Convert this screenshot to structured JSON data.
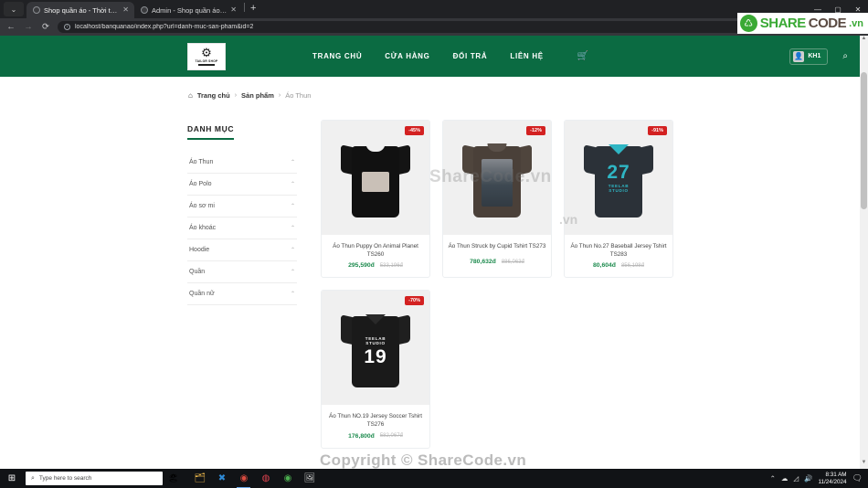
{
  "browser": {
    "tabs": [
      {
        "title": "Shop quần áo - Thời trang",
        "active": true
      },
      {
        "title": "Admin - Shop quần áo - Thời t",
        "active": false
      }
    ],
    "new_tab_label": "+",
    "tab_close_label": "✕",
    "tab_dropdown_icon": "chevron-down-icon",
    "back_label": "←",
    "forward_label": "→",
    "reload_label": "⟳",
    "url": "localhost/banquanao/index.php?url=danh-muc-san-pham&id=2",
    "info_label": "i",
    "window_minimize": "—",
    "window_maximize": "▢",
    "window_close": "✕"
  },
  "site": {
    "logo": {
      "machine_glyph": "⌨",
      "brand": "TAILOR SHOP"
    },
    "nav": [
      {
        "label": "TRANG CHỦ"
      },
      {
        "label": "CỬA HÀNG"
      },
      {
        "label": "ĐỔI TRẢ"
      },
      {
        "label": "LIÊN HỆ"
      }
    ],
    "cart_icon": "🛒",
    "user": {
      "name": "KH1",
      "avatar_glyph": "👤"
    },
    "search_icon": "⌕",
    "accent_green": "#0b6b42"
  },
  "breadcrumb": {
    "home_icon": "⌂",
    "items": [
      {
        "label": "Trang chủ",
        "current": false
      },
      {
        "label": "Sản phẩm",
        "current": false
      },
      {
        "label": "Áo Thun",
        "current": true
      }
    ],
    "separator": "›"
  },
  "sidebar": {
    "title": "DANH MỤC",
    "caret": "⌃",
    "items": [
      {
        "label": "Áo Thun"
      },
      {
        "label": "Áo Polo"
      },
      {
        "label": "Áo sơ mi"
      },
      {
        "label": "Áo khoác"
      },
      {
        "label": "Hoodie"
      },
      {
        "label": "Quần"
      },
      {
        "label": "Quần nữ"
      }
    ]
  },
  "products": [
    {
      "name": "Áo Thun Puppy On Animal Planet TS260",
      "discount": "-45%",
      "price": "295,590đ",
      "old_price": "533,196đ",
      "shirt": {
        "style": "tee",
        "body": "#111111",
        "sleeve": "#141414",
        "collar": "#1d1d1d",
        "print": "",
        "sub": ""
      }
    },
    {
      "name": "Áo Thun Struck by Cupid Tshirt TS273",
      "discount": "-12%",
      "price": "780,632đ",
      "old_price": "886,063đ",
      "shirt": {
        "style": "tee",
        "body": "#4a4039",
        "sleeve": "#4f453d",
        "collar": "#5a5049",
        "print": "",
        "sub": ""
      }
    },
    {
      "name": "Áo Thun No.27 Baseball Jersey Tshirt TS283",
      "discount": "-91%",
      "price": "80,604đ",
      "old_price": "856,198đ",
      "shirt": {
        "style": "jersey",
        "body": "#2b3138",
        "sleeve": "#2fb6c4",
        "collar": "#2fb6c4",
        "print": "27",
        "sub": "TEELAB STUDIO"
      }
    },
    {
      "name": "Áo Thun NO.19 Jersey Soccer Tshirt TS276",
      "discount": "-70%",
      "price": "176,800đ",
      "old_price": "582,067đ",
      "shirt": {
        "style": "jersey",
        "body": "#1a1a1a",
        "sleeve": "#1f1f1f",
        "collar": "#262626",
        "print": "19",
        "sub": "TEELAB STUDIO"
      }
    }
  ],
  "watermarks": {
    "center": "ShareCode.vn",
    "side": ".vn",
    "copyright": "Copyright © ShareCode.vn",
    "logo": {
      "share": "SHARE",
      "code": "CODE",
      "vn": ".vn",
      "mark": "♺"
    }
  },
  "scrollbar": {
    "up_arrow": "▲",
    "down_arrow": "▼"
  },
  "taskbar": {
    "start_icon": "⊞",
    "search_placeholder": "Type here to search",
    "search_icon": "⌕",
    "apps": [
      {
        "name": "file-explorer",
        "glyph": "🗂"
      },
      {
        "name": "vs-code",
        "glyph": "✖"
      },
      {
        "name": "google-chrome",
        "glyph": "◉"
      },
      {
        "name": "app-red",
        "glyph": "◍"
      },
      {
        "name": "app-green",
        "glyph": "◉"
      },
      {
        "name": "app-photo",
        "glyph": "🖼"
      }
    ],
    "tray": {
      "chevron": "⌃",
      "cloud": "☁",
      "network": "◿",
      "volume": "🔊",
      "notification": "🗨"
    },
    "time": "8:31 AM",
    "date": "11/24/2024"
  }
}
